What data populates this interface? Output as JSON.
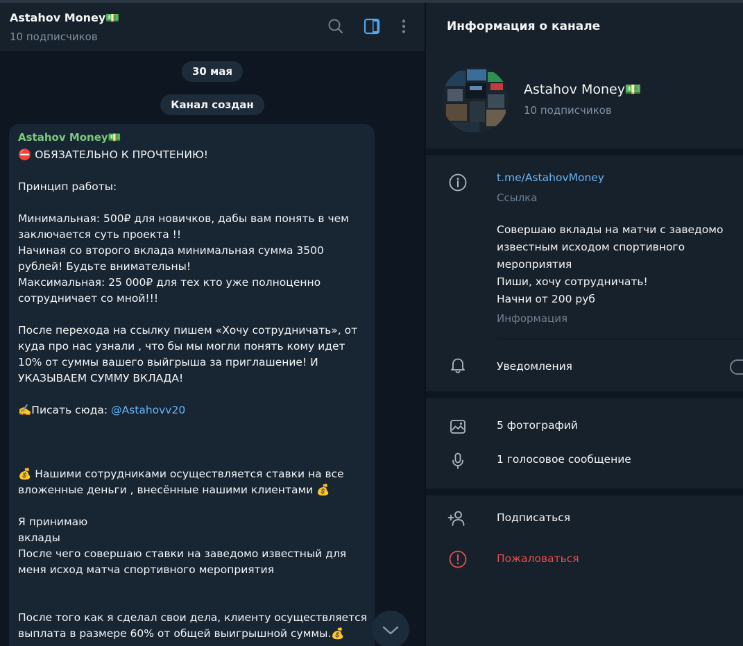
{
  "colors": {
    "background": "#0e1621",
    "panel": "#17212b",
    "bubble": "#182533",
    "author": "#7cc97c",
    "link": "#6ab3f3",
    "accent": "#4fa9f0",
    "danger": "#e64e4e",
    "muted": "#7f91a4"
  },
  "chat": {
    "title": "Astahov Money💵",
    "subtitle": "10 подписчиков",
    "icons": [
      "search-icon",
      "sidebar-toggle-icon",
      "more-vertical-icon"
    ],
    "date_pill": "30 мая",
    "service_pill": "Канал создан",
    "message": {
      "author": "Astahov Money💵",
      "lines": [
        "⛔ ОБЯЗАТЕЛЬНО К ПРОЧТЕНИЮ!",
        "",
        "Принцип работы:",
        "",
        "Минимальная:  500₽ для новичков, дабы вам понять в чем",
        "заключается суть проекта !!",
        "Начиная со второго вклада минимальная сумма 3500",
        "рублей! Будьте внимательны!",
        "Максимальная: 25 000₽ для тех кто уже полноценно",
        "сотрудничает со мной!!!",
        "",
        "После перехода на ссылку пишем  «Хочу сотрудничать», от",
        "куда про нас узнали , что бы мы могли понять кому идет",
        "10% от суммы вашего выйгрыша за приглашение!  И",
        "УКАЗЫВАЕМ СУММУ ВКЛАДА!"
      ],
      "write_here_prefix": "✍️Писать сюда: ",
      "write_here_link": "@Astahovv20",
      "lines2": [
        "",
        "",
        "",
        "💰 Нашими сотрудниками осуществляется ставки на все",
        "вложенные деньги , внесённые нашими  клиентами 💰",
        "",
        "Я принимаю",
        "вклады",
        "После чего совершаю ставки на заведомо известный для",
        "меня исход матча спортивного мероприятия",
        "",
        "",
        "После того как я сделал свои дела, клиенту осуществляется",
        "выплата в размере 60% от общей выигрышной суммы.💰"
      ]
    }
  },
  "info": {
    "title": "Информация о канале",
    "channel_name": "Astahov Money💵",
    "channel_sub": "10 подписчиков",
    "link": "t.me/AstahovMoney",
    "link_label": "Ссылка",
    "about_lines": [
      "Совершаю вклады на матчи с заведомо",
      "известным исходом спортивного",
      "мероприятия",
      "Пиши, хочу сотрудничать!",
      "Начни от 200 руб"
    ],
    "about_label": "Информация",
    "notifications": "Уведомления",
    "notifications_enabled": false,
    "photos": "5 фотографий",
    "voice": "1 голосовое сообщение",
    "subscribe": "Подписаться",
    "report": "Пожаловаться"
  }
}
